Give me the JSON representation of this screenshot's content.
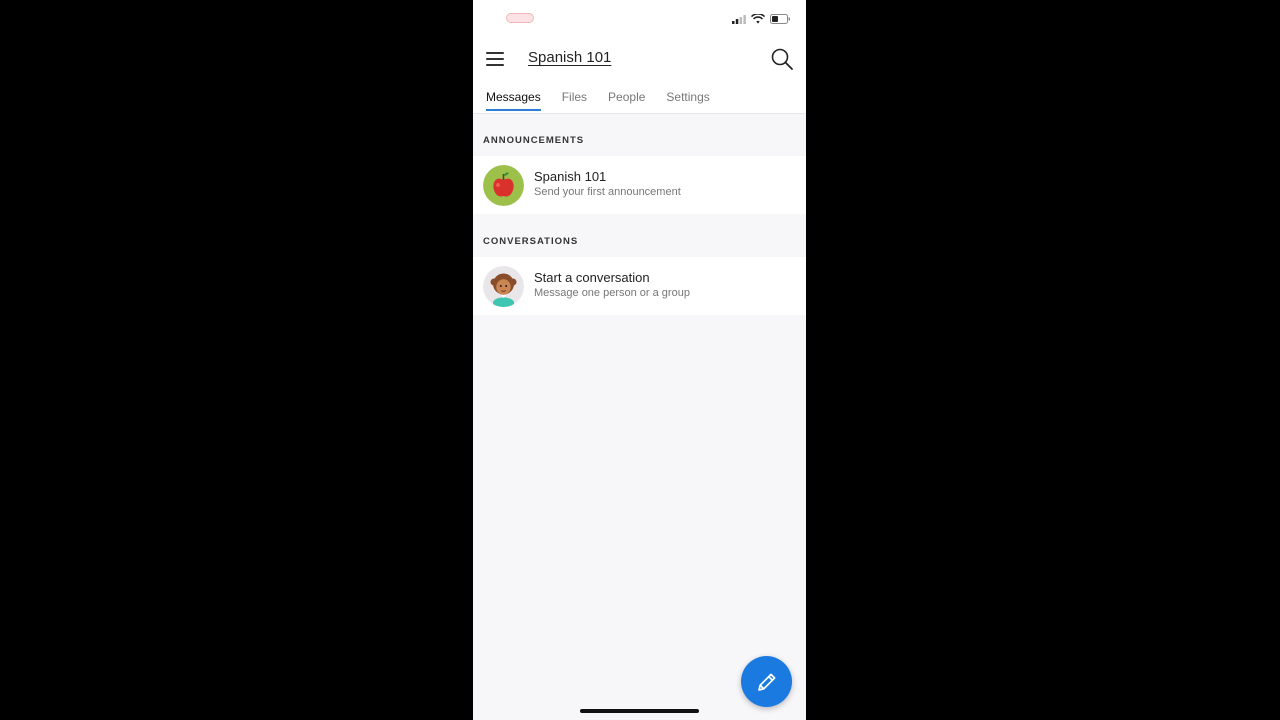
{
  "header": {
    "title": "Spanish 101"
  },
  "tabs": [
    {
      "label": "Messages",
      "active": true
    },
    {
      "label": "Files",
      "active": false
    },
    {
      "label": "People",
      "active": false
    },
    {
      "label": "Settings",
      "active": false
    }
  ],
  "announcements": {
    "section_label": "ANNOUNCEMENTS",
    "item": {
      "title": "Spanish 101",
      "subtitle": "Send your first announcement",
      "avatar_icon": "apple-avatar-icon"
    }
  },
  "conversations": {
    "section_label": "CONVERSATIONS",
    "item": {
      "title": "Start a conversation",
      "subtitle": "Message one person or a group",
      "avatar_icon": "user-avatar-icon"
    }
  },
  "fab": {
    "icon": "pencil-icon",
    "color": "#1a7ae0"
  },
  "colors": {
    "accent": "#2f7fd8"
  }
}
